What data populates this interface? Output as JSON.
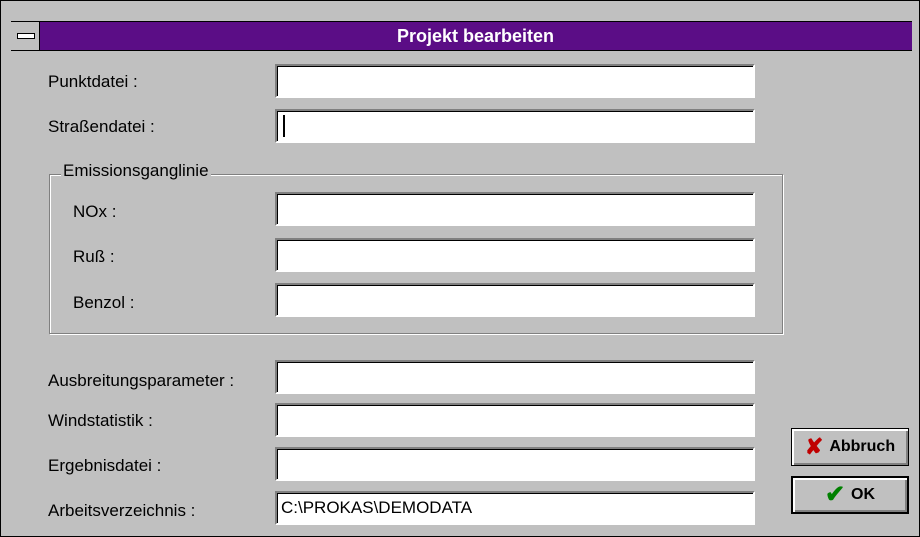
{
  "window": {
    "title": "Projekt bearbeiten"
  },
  "fields": {
    "punktdatei": {
      "label": "Punktdatei :",
      "value": ""
    },
    "strassendatei": {
      "label": "Straßendatei :",
      "value": ""
    },
    "nox": {
      "label": "NOx :",
      "value": ""
    },
    "russ": {
      "label": "Ruß :",
      "value": ""
    },
    "benzol": {
      "label": "Benzol :",
      "value": ""
    },
    "ausbreitungsparameter": {
      "label": "Ausbreitungsparameter :",
      "value": ""
    },
    "windstatistik": {
      "label": "Windstatistik :",
      "value": ""
    },
    "ergebnisdatei": {
      "label": "Ergebnisdatei :",
      "value": ""
    },
    "arbeitsverzeichnis": {
      "label": "Arbeitsverzeichnis :",
      "value": "C:\\PROKAS\\DEMODATA"
    }
  },
  "group": {
    "label": "Emissionsganglinie"
  },
  "buttons": {
    "cancel": {
      "label": "Abbruch",
      "icon": "red-x-icon"
    },
    "ok": {
      "label": "OK",
      "icon": "green-check-icon"
    }
  }
}
